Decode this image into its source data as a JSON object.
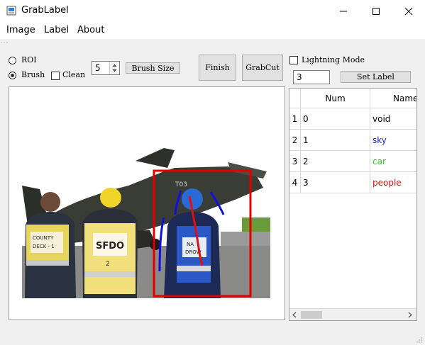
{
  "window": {
    "title": "GrabLabel"
  },
  "menu": {
    "items": [
      "Image",
      "Label",
      "About"
    ]
  },
  "tools": {
    "roi_label": "ROI",
    "brush_label": "Brush",
    "clean_label": "Clean",
    "brush_size_value": "5",
    "brush_size_button": "Brush Size",
    "finish_button": "Finish",
    "grabcut_button": "GrabCut",
    "lightning_mode_label": "Lightning Mode",
    "label_value": "3",
    "set_label_button": "Set Label",
    "selected_mode": "Brush"
  },
  "table": {
    "columns": [
      "Num",
      "Name"
    ],
    "rows": [
      {
        "index": "1",
        "num": "0",
        "name": "void",
        "color": "#000000"
      },
      {
        "index": "2",
        "num": "1",
        "name": "sky",
        "color": "#1e1ed2"
      },
      {
        "index": "3",
        "num": "2",
        "name": "car",
        "color": "#22cc22"
      },
      {
        "index": "4",
        "num": "3",
        "name": "people",
        "color": "#e01010"
      }
    ]
  },
  "image_text": {
    "vest_left_line1": "COUNTY",
    "vest_left_line2": "DECK - 1",
    "vest_mid_line1": "SFDO",
    "vest_mid_line2": "2",
    "vest_right_line1": "NA",
    "vest_right_line2": "DROW",
    "tail_code": "T03"
  },
  "colors": {
    "roi_box": "#e00000",
    "stroke_foreground": "#e01010",
    "stroke_background": "#1010e0"
  }
}
